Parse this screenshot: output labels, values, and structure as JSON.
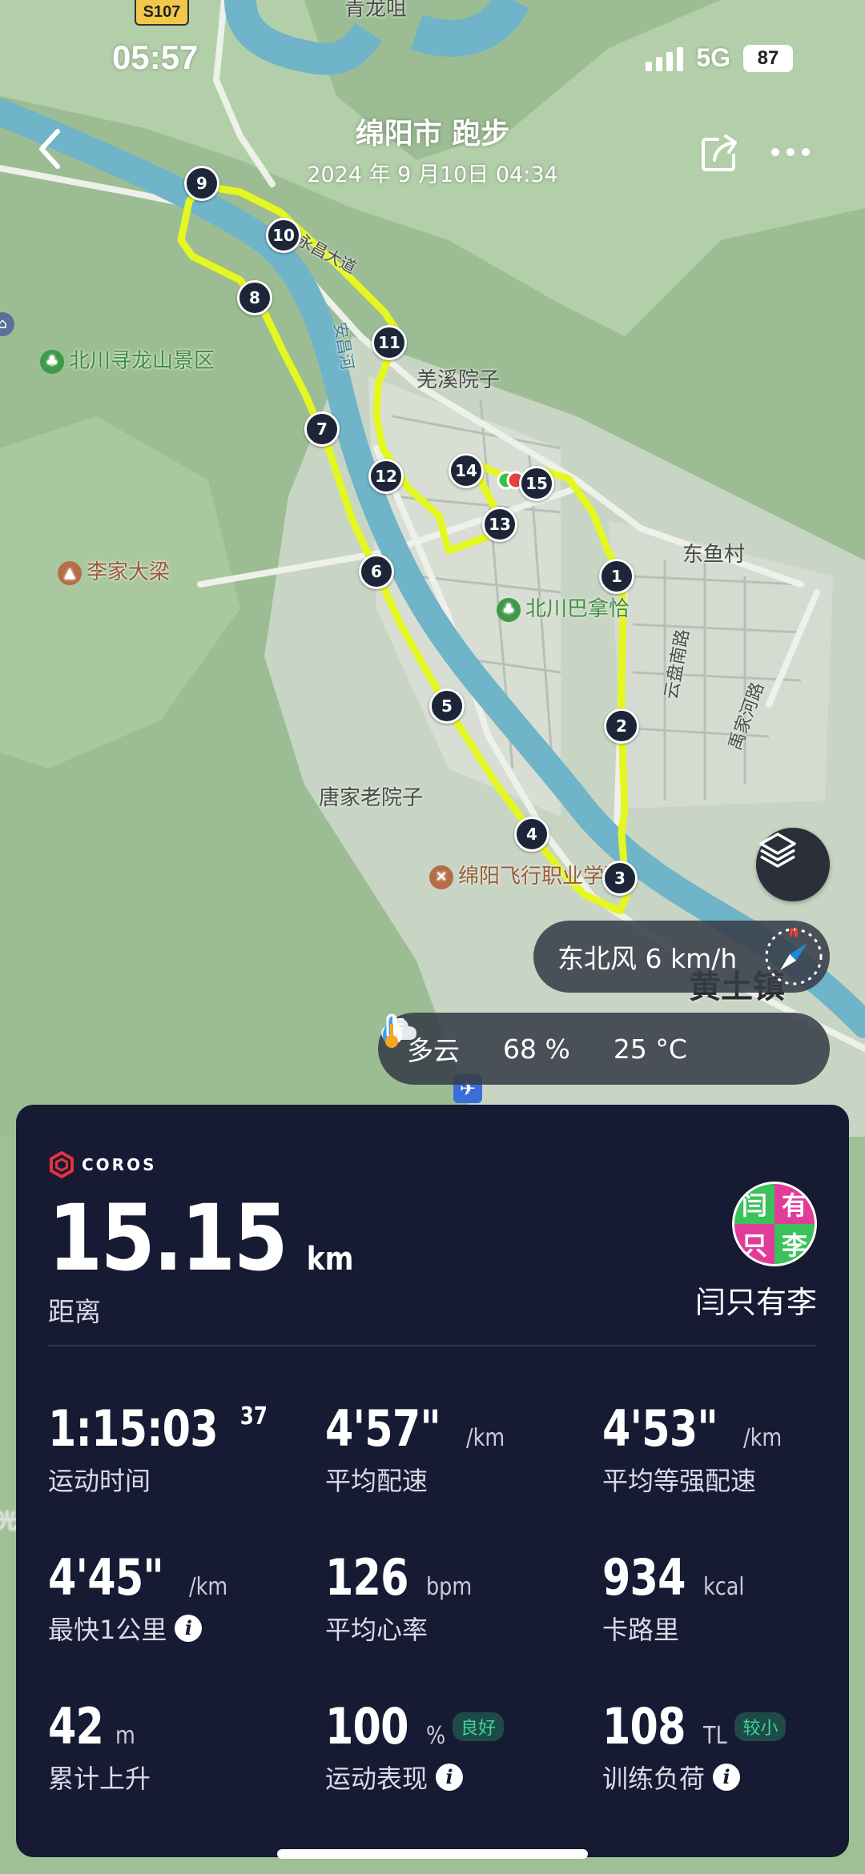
{
  "status_bar": {
    "time": "05:57",
    "network": "5G",
    "battery": "87"
  },
  "header": {
    "title": "绵阳市 跑步",
    "subtitle": "2024 年 9 月10日 04:34"
  },
  "map": {
    "road_badge": "S107",
    "labels": {
      "top_village": "青龙咀",
      "scenic": "北川寻龙山景区",
      "qiangxi": "羌溪院子",
      "dongyu": "东鱼村",
      "lijia": "李家大梁",
      "bachuan": "北川巴拿恰",
      "tangjia": "唐家老院子",
      "college": "绵阳飞行职业学院",
      "yunpan": "云盘南路",
      "road_diag": "永昌大道",
      "river": "安昌河",
      "yongjia": "禹家河路",
      "town": "黄土镇",
      "guang": "光"
    },
    "markers": [
      "1",
      "2",
      "3",
      "4",
      "5",
      "6",
      "7",
      "8",
      "9",
      "10",
      "11",
      "12",
      "13",
      "14",
      "15"
    ],
    "route_color": "#e4f720"
  },
  "wind": {
    "text": "东北风 6 km/h",
    "compass_letter": "N"
  },
  "weather": {
    "condition": "多云",
    "humidity": "68 %",
    "temperature": "25 °C"
  },
  "card": {
    "brand": "COROS",
    "distance": "15.15",
    "distance_unit": "km",
    "distance_label": "距离",
    "avatar_chars": [
      "闫",
      "有",
      "只",
      "李"
    ],
    "username": "闫只有李",
    "stats": [
      {
        "value": "1:15:03",
        "sup": "37",
        "unit": "",
        "label": "运动时间"
      },
      {
        "value": "4'57\"",
        "unit": "/km",
        "label": "平均配速"
      },
      {
        "value": "4'53\"",
        "unit": "/km",
        "label": "平均等强配速"
      },
      {
        "value": "4'45\"",
        "unit": "/km",
        "label": "最快1公里"
      },
      {
        "value": "126",
        "unit": "bpm",
        "label": "平均心率"
      },
      {
        "value": "934",
        "unit": "kcal",
        "label": "卡路里"
      },
      {
        "value": "42",
        "unit": "m",
        "label": "累计上升"
      },
      {
        "value": "100",
        "unit": "%",
        "badge": "良好",
        "label": "运动表现"
      },
      {
        "value": "108",
        "unit": "TL",
        "badge": "较小",
        "label": "训练负荷"
      }
    ]
  }
}
